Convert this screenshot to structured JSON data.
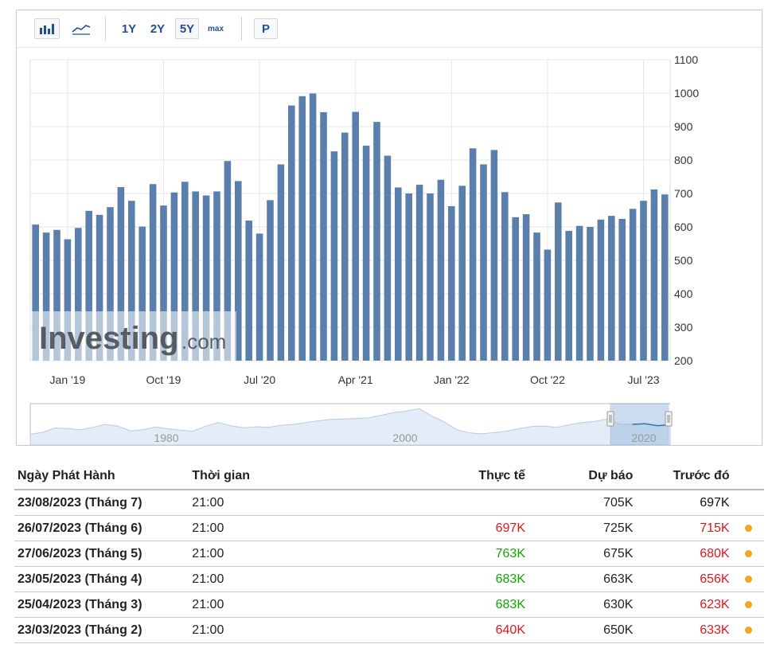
{
  "toolbar": {
    "bar_icon": "bar-chart-icon",
    "line_icon": "line-chart-icon",
    "range_1y": "1Y",
    "range_2y": "2Y",
    "range_5y": "5Y",
    "range_max": "max",
    "p_label": "P"
  },
  "watermark": {
    "brand": "Investing",
    "suffix": ".com"
  },
  "colors": {
    "bar": "#5b7fad",
    "red": "#e8141c",
    "green": "#0ea600",
    "dot": "#f0a81f",
    "accent": "#1f4f8e"
  },
  "chart_data": {
    "type": "bar",
    "y_ticks": [
      "1100",
      "1000",
      "900",
      "800",
      "700",
      "600",
      "500",
      "400",
      "300",
      "200"
    ],
    "ylim": [
      200,
      1100
    ],
    "x_tick_labels": [
      "Jan '19",
      "Oct '19",
      "Jul '20",
      "Apr '21",
      "Jan '22",
      "Oct '22",
      "Jul '23"
    ],
    "x_tick_index": [
      3,
      12,
      21,
      30,
      39,
      48,
      57
    ],
    "values": [
      607,
      583,
      591,
      563,
      597,
      648,
      636,
      659,
      719,
      678,
      601,
      728,
      664,
      703,
      735,
      706,
      694,
      706,
      797,
      737,
      619,
      580,
      680,
      787,
      963,
      991,
      999,
      943,
      826,
      882,
      944,
      843,
      914,
      813,
      718,
      700,
      726,
      700,
      741,
      662,
      723,
      835,
      787,
      830,
      704,
      629,
      638,
      583,
      532,
      673,
      588,
      603,
      600,
      622,
      633,
      624,
      654,
      678,
      712,
      697
    ],
    "navigator_labels": [
      "1980",
      "2000",
      "2020"
    ],
    "navigator_values": [
      360,
      430,
      580,
      560,
      520,
      600,
      700,
      640,
      480,
      520,
      610,
      550,
      500,
      470,
      640,
      760,
      650,
      580,
      620,
      600,
      670,
      700,
      760,
      820,
      870,
      880,
      900,
      920,
      1010,
      1100,
      1150,
      1230,
      980,
      780,
      520,
      410,
      380,
      420,
      470,
      560,
      630,
      640,
      600,
      690,
      760,
      800,
      880,
      700,
      700,
      720,
      650,
      690
    ]
  },
  "table": {
    "headers": {
      "date": "Ngày Phát Hành",
      "time": "Thời gian",
      "actual": "Thực tế",
      "forecast": "Dự báo",
      "previous": "Trước đó"
    },
    "rows": [
      {
        "date": "23/08/2023 (Tháng 7)",
        "time": "21:00",
        "actual": "",
        "actual_color": "#222222",
        "forecast": "705K",
        "previous": "697K",
        "previous_color": "#111111",
        "dot": false
      },
      {
        "date": "26/07/2023 (Tháng 6)",
        "time": "21:00",
        "actual": "697K",
        "actual_color": "#e8141c",
        "forecast": "725K",
        "previous": "715K",
        "previous_color": "#e8141c",
        "dot": true
      },
      {
        "date": "27/06/2023 (Tháng 5)",
        "time": "21:00",
        "actual": "763K",
        "actual_color": "#0ea600",
        "forecast": "675K",
        "previous": "680K",
        "previous_color": "#e8141c",
        "dot": true
      },
      {
        "date": "23/05/2023 (Tháng 4)",
        "time": "21:00",
        "actual": "683K",
        "actual_color": "#0ea600",
        "forecast": "663K",
        "previous": "656K",
        "previous_color": "#e8141c",
        "dot": true
      },
      {
        "date": "25/04/2023 (Tháng 3)",
        "time": "21:00",
        "actual": "683K",
        "actual_color": "#0ea600",
        "forecast": "630K",
        "previous": "623K",
        "previous_color": "#e8141c",
        "dot": true
      },
      {
        "date": "23/03/2023 (Tháng 2)",
        "time": "21:00",
        "actual": "640K",
        "actual_color": "#e8141c",
        "forecast": "650K",
        "previous": "633K",
        "previous_color": "#e8141c",
        "dot": true
      }
    ]
  }
}
